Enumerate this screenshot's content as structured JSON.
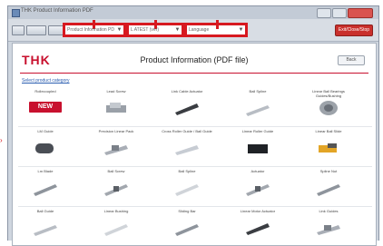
{
  "window": {
    "title": "THK Product Information PDF"
  },
  "toolbar": {
    "combo1": "Product Information PDF",
    "combo2": "L ATEST (ver)",
    "combo3": "Language",
    "exit_label": "Exit/Close/Stop"
  },
  "header": {
    "logo": "THK",
    "title": "Product Information (PDF file)",
    "back_label": "Back"
  },
  "section": {
    "link": "Select product category"
  },
  "products": [
    {
      "label": "Rollecoupled",
      "shape": "new"
    },
    {
      "label": "Lead Screw",
      "shape": "block"
    },
    {
      "label": "Link Cable Actuator",
      "shape": "rod-dark"
    },
    {
      "label": "Ball Spline",
      "shape": "shaft"
    },
    {
      "label": "Linear Ball Bearings Guides/Bushing",
      "shape": "cylinder"
    },
    {
      "label": "LM Guide",
      "shape": "cylinder-dark"
    },
    {
      "label": "Precision Linear Pack",
      "shape": "rail"
    },
    {
      "label": "Cross Roller Guide / Ball Guide",
      "shape": "rail-light"
    },
    {
      "label": "Linear Roller Guide",
      "shape": "block-dark"
    },
    {
      "label": "Linear Ball Slide",
      "shape": "block-yellow"
    },
    {
      "label": "Lm Blade",
      "shape": "rod"
    },
    {
      "label": "Ball Screw",
      "shape": "screw"
    },
    {
      "label": "Ball Spline",
      "shape": "rod-light"
    },
    {
      "label": "Actuator",
      "shape": "screw"
    },
    {
      "label": "Spline Nut",
      "shape": "rod"
    },
    {
      "label": "Ball Guide",
      "shape": "shaft"
    },
    {
      "label": "Linear Bushing",
      "shape": "rod-light"
    },
    {
      "label": "Sliding Bar",
      "shape": "rod"
    },
    {
      "label": "Linear Motor Actuator",
      "shape": "rod-dark"
    },
    {
      "label": "Link Guides",
      "shape": "rail"
    }
  ],
  "colors": {
    "highlight": "#d71920",
    "brand": "#c8102e"
  }
}
